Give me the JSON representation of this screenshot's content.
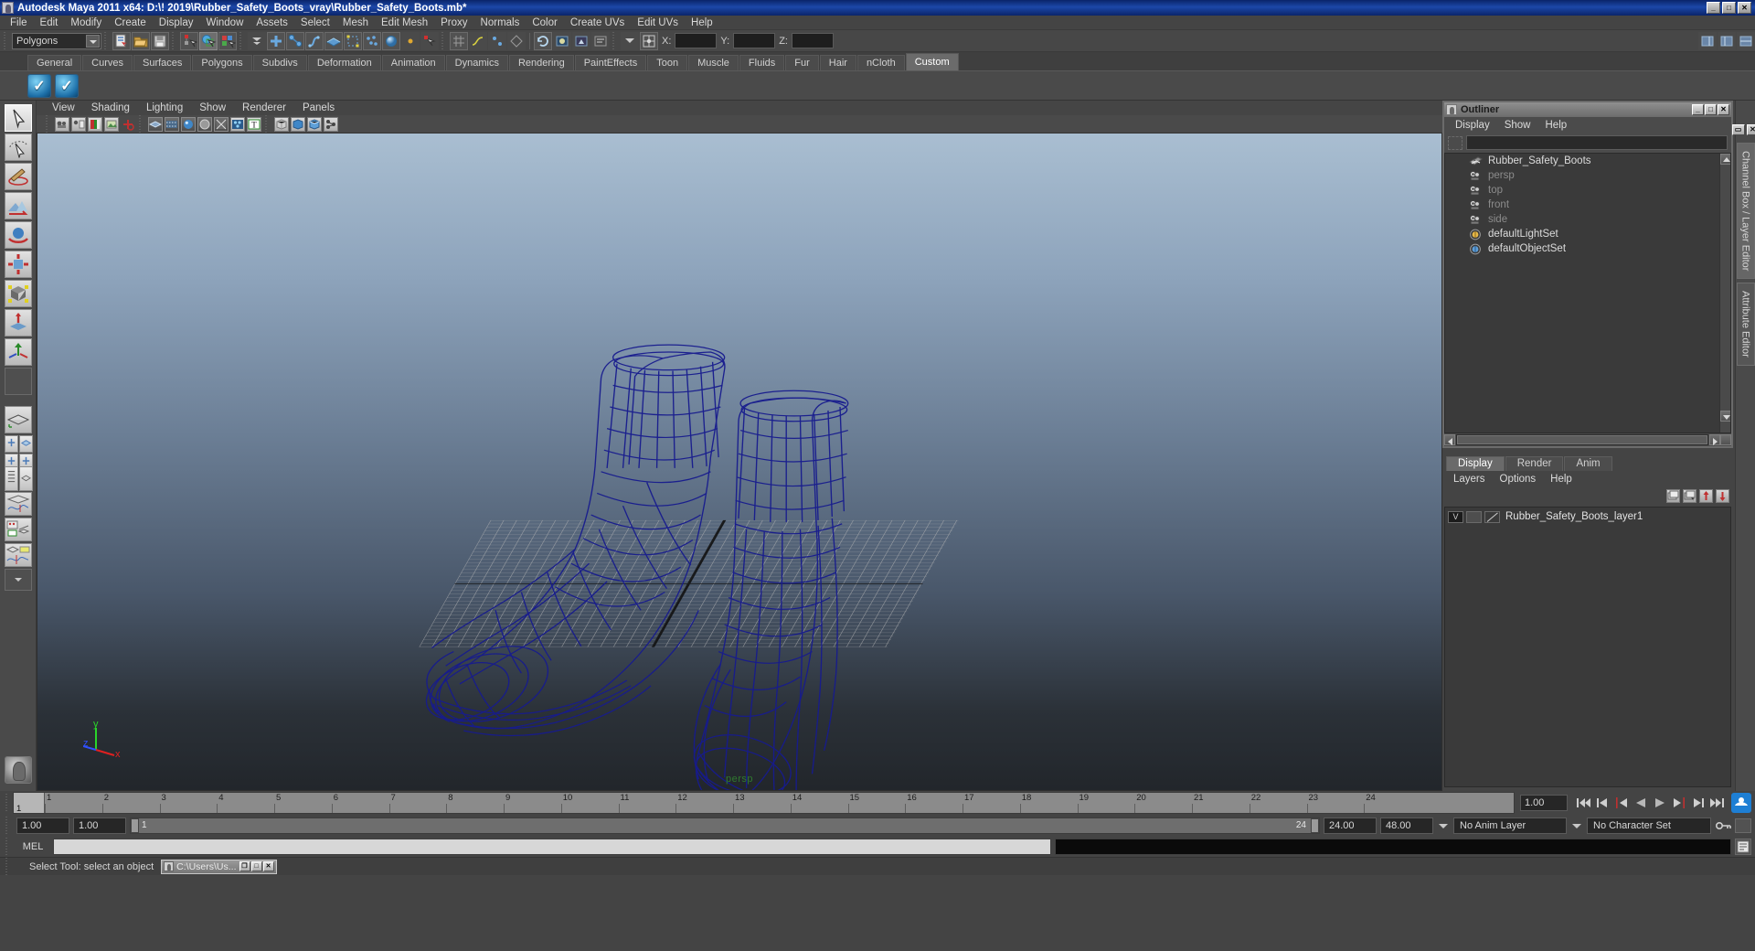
{
  "window": {
    "title": "Autodesk Maya 2011 x64: D:\\! 2019\\Rubber_Safety_Boots_vray\\Rubber_Safety_Boots.mb*",
    "minimize": "_",
    "maximize": "□",
    "close": "✕",
    "title_bar_color": "#0a246a"
  },
  "menubar": {
    "items": [
      "File",
      "Edit",
      "Modify",
      "Create",
      "Display",
      "Window",
      "Assets",
      "Select",
      "Mesh",
      "Edit Mesh",
      "Proxy",
      "Normals",
      "Color",
      "Create UVs",
      "Edit UVs",
      "Help"
    ]
  },
  "statusline": {
    "menu_set": "Polygons",
    "axis_labels": {
      "x": "X:",
      "y": "Y:",
      "z": "Z:"
    },
    "x_value": "",
    "y_value": "",
    "z_value": ""
  },
  "shelf": {
    "tabs": [
      "General",
      "Curves",
      "Surfaces",
      "Polygons",
      "Subdivs",
      "Deformation",
      "Animation",
      "Dynamics",
      "Rendering",
      "PaintEffects",
      "Toon",
      "Muscle",
      "Fluids",
      "Fur",
      "Hair",
      "nCloth",
      "Custom"
    ],
    "active_tab": "Custom",
    "buttons": [
      "vray-check-icon-1",
      "vray-check-icon-2"
    ]
  },
  "viewport": {
    "menu": [
      "View",
      "Shading",
      "Lighting",
      "Show",
      "Renderer",
      "Panels"
    ],
    "camera_label": "persp",
    "axis": {
      "x": "x",
      "y": "y",
      "z": "z",
      "x_color": "#e02020",
      "y_color": "#2ad42a",
      "z_color": "#3050ff"
    },
    "wireframe_color": "#161a8c",
    "grid_color": "#b9b9b9",
    "background_top": "#a8bdd0",
    "background_bottom": "#23272c",
    "object": "Rubber_Safety_Boots"
  },
  "outliner": {
    "title": "Outliner",
    "menu": [
      "Display",
      "Show",
      "Help"
    ],
    "search_value": "",
    "items": [
      {
        "label": "Rubber_Safety_Boots",
        "icon": "mesh-icon",
        "dim": false
      },
      {
        "label": "persp",
        "icon": "camera-icon",
        "dim": true
      },
      {
        "label": "top",
        "icon": "camera-icon",
        "dim": true
      },
      {
        "label": "front",
        "icon": "camera-icon",
        "dim": true
      },
      {
        "label": "side",
        "icon": "camera-icon",
        "dim": true
      },
      {
        "label": "defaultLightSet",
        "icon": "set-icon",
        "dim": false
      },
      {
        "label": "defaultObjectSet",
        "icon": "set-icon",
        "dim": false
      }
    ],
    "win_buttons": {
      "min": "_",
      "max": "□",
      "close": "✕"
    }
  },
  "layer_editor": {
    "tabs": [
      "Display",
      "Render",
      "Anim"
    ],
    "active_tab": "Display",
    "menu": [
      "Layers",
      "Options",
      "Help"
    ],
    "layers": [
      {
        "visibility": "V",
        "playback": "",
        "name": "Rubber_Safety_Boots_layer1"
      }
    ]
  },
  "right_tabs": {
    "items": [
      "Channel Box / Layer Editor",
      "Attribute Editor"
    ],
    "active": "Channel Box / Layer Editor"
  },
  "timeline": {
    "start_frame": "1",
    "end_frame": "24",
    "current_frame": "1",
    "current_frame_field": "1.00",
    "ticks": [
      "1",
      "2",
      "3",
      "4",
      "5",
      "6",
      "7",
      "8",
      "9",
      "10",
      "11",
      "12",
      "13",
      "14",
      "15",
      "16",
      "17",
      "18",
      "19",
      "20",
      "21",
      "22",
      "23",
      "24"
    ],
    "playback_buttons": [
      "go-to-start-icon",
      "step-back-keyframe-icon",
      "step-back-frame-icon",
      "play-backwards-icon",
      "play-forwards-icon",
      "step-forward-frame-icon",
      "step-forward-keyframe-icon",
      "go-to-end-icon"
    ]
  },
  "range_slider": {
    "anim_start": "1.00",
    "range_start": "1.00",
    "range_bar_start": "1",
    "range_bar_end": "24",
    "range_end": "24.00",
    "anim_end": "48.00",
    "anim_layer": "No Anim Layer",
    "character_set": "No Character Set"
  },
  "command_line": {
    "label": "MEL",
    "input_value": "",
    "output_value": ""
  },
  "help_line": {
    "text": "Select Tool: select an object"
  },
  "taskbar_window": {
    "title": "C:\\Users\\Us...",
    "buttons": {
      "restore": "❐",
      "max": "□",
      "close": "✕"
    }
  },
  "toolbox": {
    "tools": [
      "select-tool",
      "lasso-select-tool",
      "paint-select-tool",
      "soft-modification-tool",
      "move-tool",
      "rotate-tool",
      "scale-tool",
      "show-manipulator-tool",
      "last-tool-used",
      "blank-tool"
    ],
    "layouts": [
      "single-perspective-view",
      "four-view-layout",
      "outliner-persp-layout",
      "persp-graph-layout",
      "hypershade-persp-layout",
      "persp-graph-trax-layout",
      "more-layouts"
    ]
  }
}
